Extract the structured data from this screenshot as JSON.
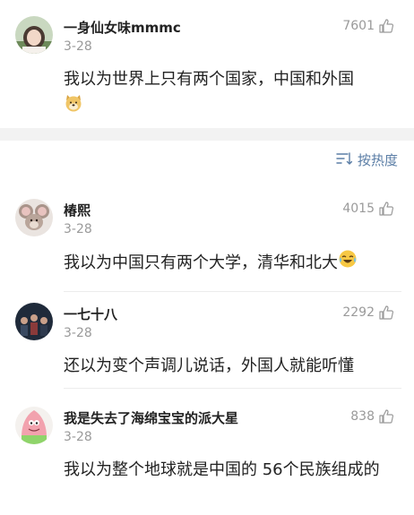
{
  "comments": [
    {
      "username": "一身仙女味mmmc",
      "date": "3-28",
      "likes": "7601",
      "text": "我以为世界上只有两个国家，中国和外国"
    },
    {
      "username": "椿熙",
      "date": "3-28",
      "likes": "4015",
      "text": "我以为中国只有两个大学，清华和北大"
    },
    {
      "username": "一七十八",
      "date": "3-28",
      "likes": "2292",
      "text": "还以为变个声调儿说话，外国人就能听懂"
    },
    {
      "username": "我是失去了海绵宝宝的派大星",
      "date": "3-28",
      "likes": "838",
      "text": "我以为整个地球就是中国的 56个民族组成的"
    }
  ],
  "sort": {
    "label": "按热度",
    "icon": "sort-icon"
  },
  "icons": {
    "like": "thumbs-up-icon",
    "emoji_doge": "doge-emoji-icon",
    "emoji_laugh": "laugh-cry-emoji-icon"
  },
  "colors": {
    "link_blue": "#5b7ea6",
    "meta_gray": "#9a9a9a",
    "section_gap": "#f2f2f2"
  }
}
